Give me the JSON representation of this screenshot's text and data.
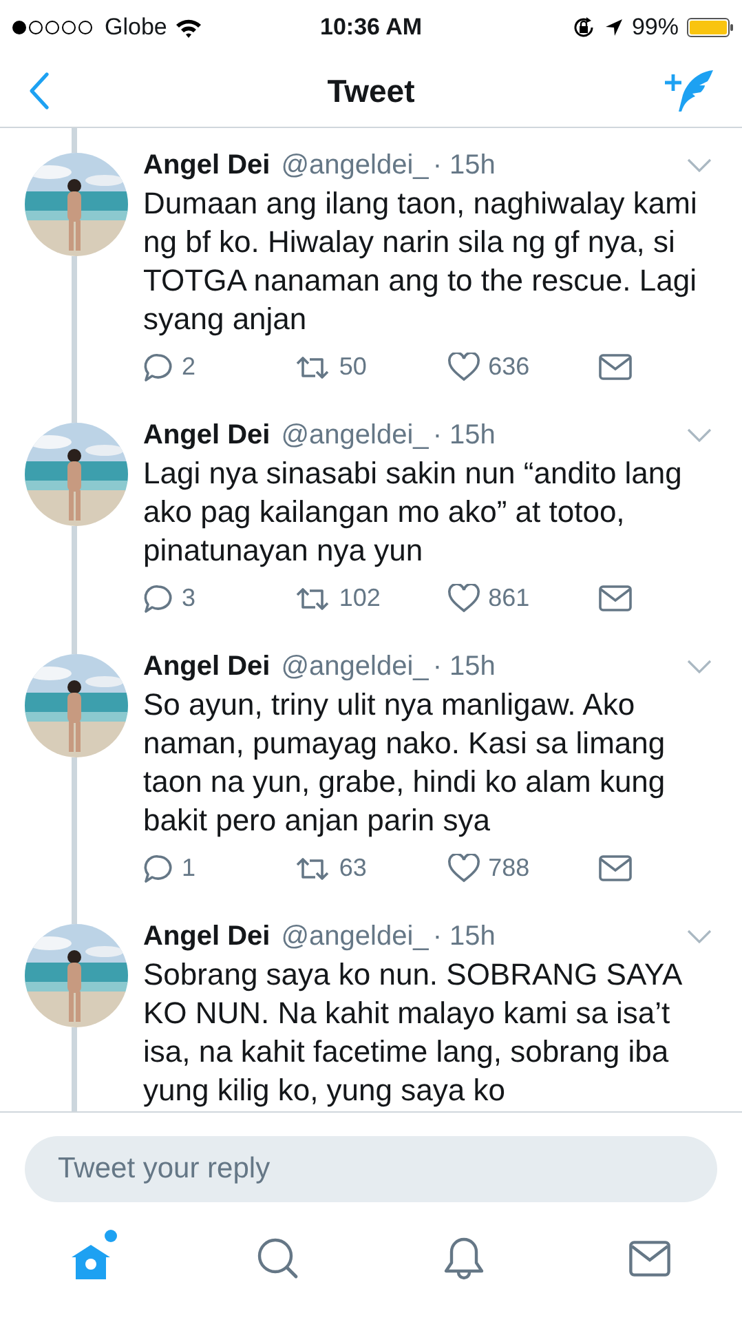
{
  "status_bar": {
    "carrier": "Globe",
    "time": "10:36 AM",
    "battery": "99%"
  },
  "nav": {
    "title": "Tweet"
  },
  "tweets": [
    {
      "name": "Angel Dei",
      "handle": "@angeldei_",
      "time": "· 15h",
      "text": "Dumaan ang ilang taon, naghiwalay kami ng bf ko. Hiwalay narin sila ng gf nya, si TOTGA nanaman ang to the rescue. Lagi syang anjan",
      "replies": "2",
      "retweets": "50",
      "likes": "636"
    },
    {
      "name": "Angel Dei",
      "handle": "@angeldei_",
      "time": "· 15h",
      "text": "Lagi nya sinasabi sakin nun “andito lang ako pag kailangan mo ako” at totoo, pinatunayan nya yun",
      "replies": "3",
      "retweets": "102",
      "likes": "861"
    },
    {
      "name": "Angel Dei",
      "handle": "@angeldei_",
      "time": "· 15h",
      "text": "So ayun, triny ulit nya manligaw. Ako naman, pumayag nako. Kasi sa limang taon na yun, grabe, hindi ko alam kung bakit pero anjan parin sya",
      "replies": "1",
      "retweets": "63",
      "likes": "788"
    },
    {
      "name": "Angel Dei",
      "handle": "@angeldei_",
      "time": "· 15h",
      "text": "Sobrang saya ko nun. SOBRANG SAYA KO NUN. Na kahit malayo kami sa isa’t isa, na kahit facetime lang, sobrang iba yung kilig ko, yung saya ko"
    }
  ],
  "reply": {
    "placeholder": "Tweet your reply"
  },
  "tabs": [
    {
      "kind": "home",
      "selected": true,
      "dot": true
    },
    {
      "kind": "search",
      "selected": false,
      "dot": false
    },
    {
      "kind": "notifications",
      "selected": false,
      "dot": false
    },
    {
      "kind": "messages",
      "selected": false,
      "dot": false
    }
  ]
}
